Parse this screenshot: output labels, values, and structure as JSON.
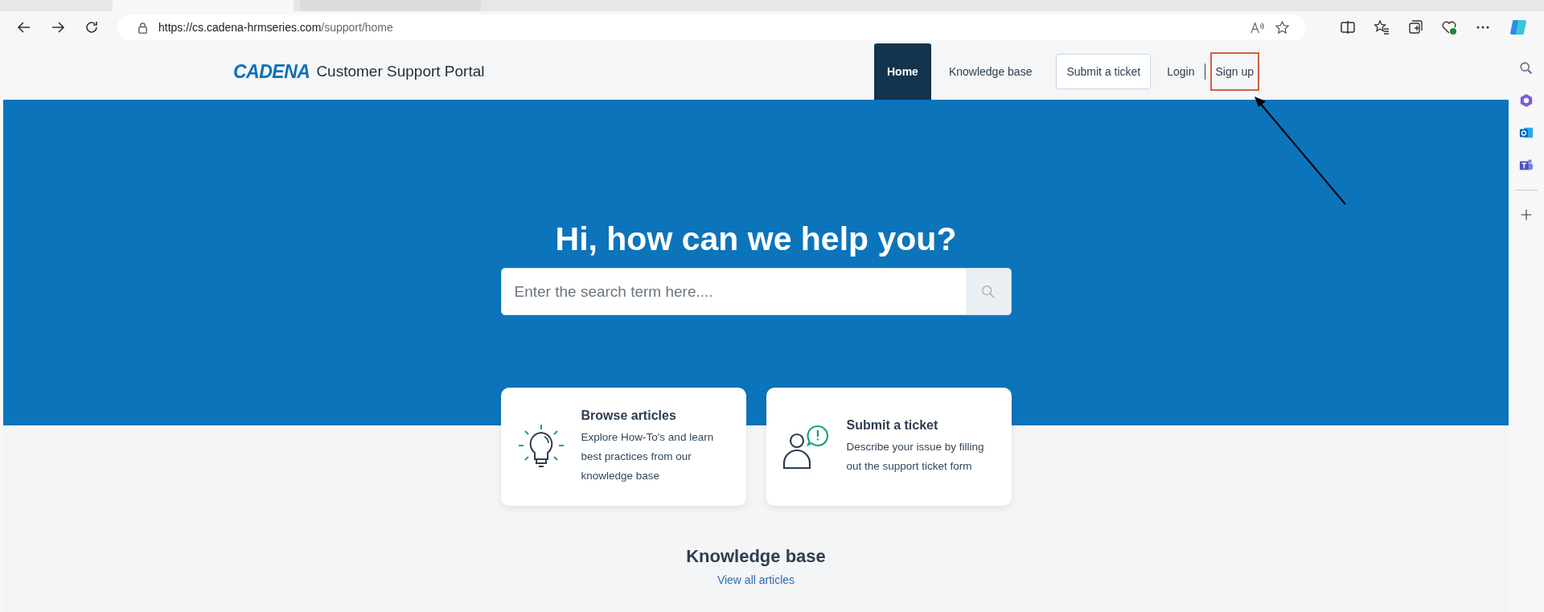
{
  "browser": {
    "url_host": "https://cs.cadena-hrmseries.com",
    "url_path": "/support/home"
  },
  "header": {
    "logo": "CADENA",
    "title": "Customer Support Portal",
    "nav": [
      {
        "label": "Home",
        "kind": "tab",
        "selected": true
      },
      {
        "label": "Knowledge base",
        "kind": "tab",
        "selected": false
      },
      {
        "label": "Submit a ticket",
        "kind": "outlined",
        "selected": false
      },
      {
        "label": "Login",
        "kind": "link",
        "selected": false
      },
      {
        "label": "Sign up",
        "kind": "link",
        "selected": false
      }
    ]
  },
  "hero": {
    "title": "Hi, how can we help you?",
    "search": {
      "placeholder": "Enter the search term here...."
    }
  },
  "cards": [
    {
      "kind": "bulb",
      "title": "Browse articles",
      "text": "Explore How-To's and learn best practices from our knowledge base"
    },
    {
      "kind": "person",
      "title": "Submit a ticket",
      "text": "Describe your issue by filling out the support ticket form"
    }
  ],
  "knowledge_base": {
    "title": "Knowledge base",
    "link": "View all articles"
  }
}
